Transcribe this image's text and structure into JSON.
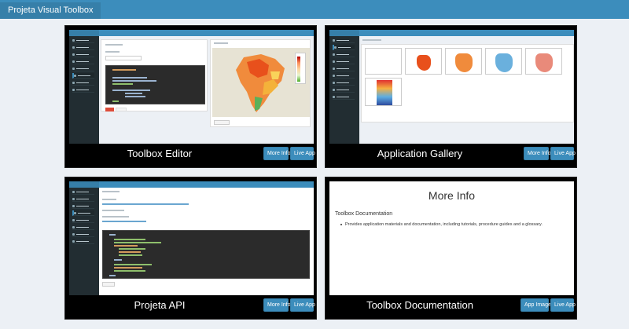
{
  "header": {
    "app_title": "Projeta Visual Toolbox"
  },
  "cards": [
    {
      "caption": "Toolbox Editor",
      "buttons": [
        "More Info",
        "Live App"
      ]
    },
    {
      "caption": "Application Gallery",
      "buttons": [
        "More Info",
        "Live App"
      ]
    },
    {
      "caption": "Projeta API",
      "buttons": [
        "More Info",
        "Live App"
      ]
    },
    {
      "caption": "Toolbox Documentation",
      "buttons": [
        "App Image",
        "Live App"
      ],
      "info": {
        "title": "More Info",
        "subtitle": "Toolbox Documentation",
        "bullet": "Provides application materials and documentation, including tutorials, procedure guides and a glossary."
      }
    }
  ],
  "colors": {
    "header": "#3c8dbc",
    "header_title_bg": "#367fa9",
    "button": "#3c8dbc",
    "card_bg": "#000000",
    "page_bg": "#ecf0f5",
    "sidebar": "#222d32"
  }
}
